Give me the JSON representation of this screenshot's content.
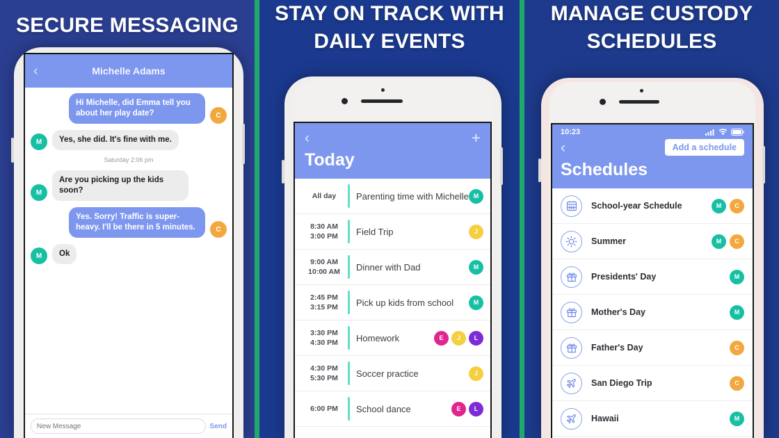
{
  "theme": {
    "panel_bg": "#25408f",
    "divider_green": "#1faa6b",
    "app_blue": "#7d97ef",
    "accent_teal": "#17bfa3",
    "accent_orange": "#f3a83f",
    "accent_pink": "#e0258f",
    "accent_yellow": "#f6cf3f",
    "accent_purple": "#7c2bd6",
    "event_bar": "#5ee0c8"
  },
  "panels": [
    {
      "headline": "SECURE MESSAGING"
    },
    {
      "headline": "STAY ON TRACK WITH DAILY EVENTS"
    },
    {
      "headline": "MANAGE CUSTODY SCHEDULES"
    }
  ],
  "messaging": {
    "back_icon": "chevron-left-icon",
    "contact_name": "Michelle Adams",
    "messages": [
      {
        "id": "m1",
        "side": "out",
        "text": "Hi Michelle, did Emma tell you about her play date?",
        "avatar": "C",
        "avatar_color": "orange"
      },
      {
        "id": "m2",
        "side": "in",
        "text": "Yes, she did. It's fine with me.",
        "avatar": "M",
        "avatar_color": "teal"
      },
      {
        "id": "m3",
        "side": "in",
        "text": "Are you picking up the kids soon?",
        "avatar": "M",
        "avatar_color": "teal"
      },
      {
        "id": "m4",
        "side": "out",
        "text": "Yes. Sorry! Traffic is super-heavy. I'll be there in 5 minutes.",
        "avatar": "C",
        "avatar_color": "orange"
      },
      {
        "id": "m5",
        "side": "in",
        "text": "Ok",
        "avatar": "M",
        "avatar_color": "teal"
      }
    ],
    "timestamp": "Saturday 2:06 pm",
    "compose_placeholder": "New Message",
    "send_label": "Send"
  },
  "calendar": {
    "back_icon": "chevron-left-icon",
    "add_icon": "plus-icon",
    "title": "Today",
    "events": [
      {
        "start": "All day",
        "end": "",
        "name": "Parenting time with Michelle",
        "avatars": [
          {
            "initial": "M",
            "color": "teal"
          }
        ]
      },
      {
        "start": "8:30 AM",
        "end": "3:00 PM",
        "name": "Field Trip",
        "avatars": [
          {
            "initial": "J",
            "color": "yellow"
          }
        ]
      },
      {
        "start": "9:00 AM",
        "end": "10:00 AM",
        "name": "Dinner with Dad",
        "avatars": [
          {
            "initial": "M",
            "color": "teal"
          }
        ]
      },
      {
        "start": "2:45 PM",
        "end": "3:15 PM",
        "name": "Pick up kids from school",
        "avatars": [
          {
            "initial": "M",
            "color": "teal"
          }
        ]
      },
      {
        "start": "3:30 PM",
        "end": "4:30 PM",
        "name": "Homework",
        "avatars": [
          {
            "initial": "E",
            "color": "pink"
          },
          {
            "initial": "J",
            "color": "yellow"
          },
          {
            "initial": "L",
            "color": "purple"
          }
        ]
      },
      {
        "start": "4:30 PM",
        "end": "5:30 PM",
        "name": "Soccer practice",
        "avatars": [
          {
            "initial": "J",
            "color": "yellow"
          }
        ]
      },
      {
        "start": "6:00 PM",
        "end": "",
        "name": "School dance",
        "avatars": [
          {
            "initial": "E",
            "color": "pink"
          },
          {
            "initial": "L",
            "color": "purple"
          }
        ]
      }
    ]
  },
  "schedules": {
    "status_time": "10:23",
    "status_icons": [
      "signal-icon",
      "wifi-icon",
      "battery-icon"
    ],
    "back_icon": "chevron-left-icon",
    "add_button_label": "Add a schedule",
    "title": "Schedules",
    "items": [
      {
        "icon": "calendar-grid-icon",
        "name": "School-year Schedule",
        "avatars": [
          {
            "initial": "M",
            "color": "teal"
          },
          {
            "initial": "C",
            "color": "orange"
          }
        ]
      },
      {
        "icon": "sun-icon",
        "name": "Summer",
        "avatars": [
          {
            "initial": "M",
            "color": "teal"
          },
          {
            "initial": "C",
            "color": "orange"
          }
        ]
      },
      {
        "icon": "gift-icon",
        "name": "Presidents' Day",
        "avatars": [
          {
            "initial": "M",
            "color": "teal"
          }
        ]
      },
      {
        "icon": "gift-icon",
        "name": "Mother's Day",
        "avatars": [
          {
            "initial": "M",
            "color": "teal"
          }
        ]
      },
      {
        "icon": "gift-icon",
        "name": "Father's Day",
        "avatars": [
          {
            "initial": "C",
            "color": "orange"
          }
        ]
      },
      {
        "icon": "airplane-icon",
        "name": "San Diego Trip",
        "avatars": [
          {
            "initial": "C",
            "color": "orange"
          }
        ]
      },
      {
        "icon": "airplane-icon",
        "name": "Hawaii",
        "avatars": [
          {
            "initial": "M",
            "color": "teal"
          }
        ]
      }
    ]
  }
}
